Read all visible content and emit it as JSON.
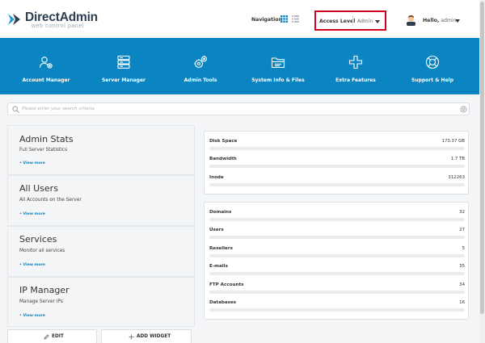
{
  "brand": {
    "name": "DirectAdmin",
    "tagline": "web control panel"
  },
  "header": {
    "navigation_label": "Navigation",
    "access_level_label": "Access Level",
    "access_level_value": "Admin",
    "greeting": "Hello,",
    "username": "admin"
  },
  "menu": [
    {
      "label": "Account Manager",
      "icon": "account-manager-icon"
    },
    {
      "label": "Server Manager",
      "icon": "server-manager-icon"
    },
    {
      "label": "Admin Tools",
      "icon": "admin-tools-icon"
    },
    {
      "label": "System Info & Files",
      "icon": "system-info-icon"
    },
    {
      "label": "Extra Features",
      "icon": "extra-features-icon"
    },
    {
      "label": "Support & Help",
      "icon": "support-help-icon"
    }
  ],
  "search": {
    "placeholder": "Please enter your search criteria",
    "value": ""
  },
  "cards": [
    {
      "title": "Admin Stats",
      "subtitle": "Full Server Statistics",
      "link": "• View more"
    },
    {
      "title": "All Users",
      "subtitle": "All Accounts on the Server",
      "link": "• View more"
    },
    {
      "title": "Services",
      "subtitle": "Monitor all services",
      "link": "• View more"
    },
    {
      "title": "IP Manager",
      "subtitle": "Manage Server IPs",
      "link": "• View more"
    }
  ],
  "buttons": {
    "edit": "EDIT",
    "add_widget": "ADD WIDGET"
  },
  "usage": [
    {
      "label": "Disk Space",
      "value": "173.37 GB",
      "fill": 0
    },
    {
      "label": "Bandwidth",
      "value": "1.7 TB",
      "fill": 0
    },
    {
      "label": "Inode",
      "value": "312263",
      "fill": 0
    }
  ],
  "counts": [
    {
      "label": "Domains",
      "value": "32",
      "fill": 0
    },
    {
      "label": "Users",
      "value": "27",
      "fill": 0
    },
    {
      "label": "Resellers",
      "value": "5",
      "fill": 0
    },
    {
      "label": "E-mails",
      "value": "35",
      "fill": 0
    },
    {
      "label": "FTP Accounts",
      "value": "34",
      "fill": 0
    },
    {
      "label": "Databases",
      "value": "16",
      "fill": 0
    }
  ],
  "colors": {
    "primary": "#0a85c1",
    "highlight": "#d0021b",
    "text": "#333333",
    "background": "#f4f5f7"
  }
}
